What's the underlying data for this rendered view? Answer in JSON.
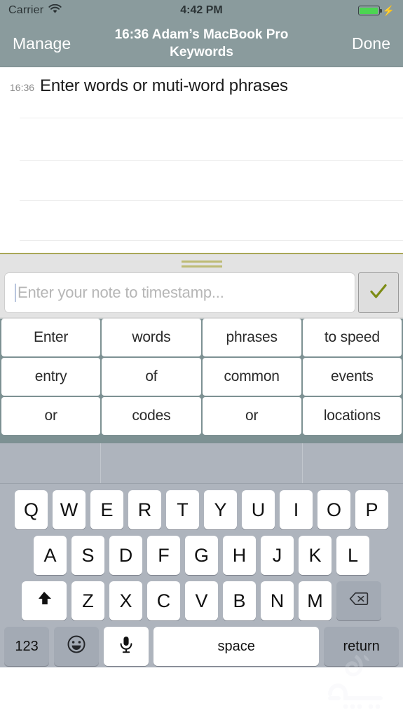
{
  "status_bar": {
    "carrier": "Carrier",
    "wifi_icon": "wifi-icon",
    "time": "4:42 PM",
    "battery_icon": "battery-full-icon",
    "charging_icon": "lightning-bolt-icon"
  },
  "nav_bar": {
    "left_button": "Manage",
    "title": "16:36 Adam’s MacBook Pro Keywords",
    "right_button": "Done"
  },
  "notes": {
    "entries": [
      {
        "time": "16:36",
        "text": "Enter words or muti-word phrases"
      }
    ],
    "rule_count": 4
  },
  "input_panel": {
    "grabber_icon": "drag-handle-icon",
    "placeholder": "Enter your note to timestamp...",
    "value": "",
    "confirm_icon": "checkmark-icon",
    "accent_color": "#7d8c15",
    "divider_color": "#a9a757"
  },
  "keyword_grid": {
    "rows": [
      [
        "Enter",
        "words",
        "phrases",
        "to speed"
      ],
      [
        "entry",
        "of",
        "common",
        "events"
      ],
      [
        "or",
        "codes",
        "or",
        "locations"
      ]
    ]
  },
  "keyboard": {
    "predictions": [
      "",
      "",
      ""
    ],
    "row1": [
      "Q",
      "W",
      "E",
      "R",
      "T",
      "Y",
      "U",
      "I",
      "O",
      "P"
    ],
    "row2": [
      "A",
      "S",
      "D",
      "F",
      "G",
      "H",
      "J",
      "K",
      "L"
    ],
    "row3": [
      "Z",
      "X",
      "C",
      "V",
      "B",
      "N",
      "M"
    ],
    "shift_icon": "shift-up-arrow-icon",
    "backspace_icon": "backspace-delete-icon",
    "numbers_key": "123",
    "emoji_icon": "smiley-emoji-icon",
    "dictation_icon": "microphone-icon",
    "space_key": "space",
    "return_key": "return"
  },
  "watermark": {
    "name": "arabic-site-logo-watermark"
  },
  "colors": {
    "nav_background": "#8a9b9d",
    "slate": "#7d9193",
    "keyboard_background": "#aeb4bd",
    "key_white": "#ffffff",
    "key_dark": "#a3aab4",
    "battery_green": "#4cd552"
  }
}
